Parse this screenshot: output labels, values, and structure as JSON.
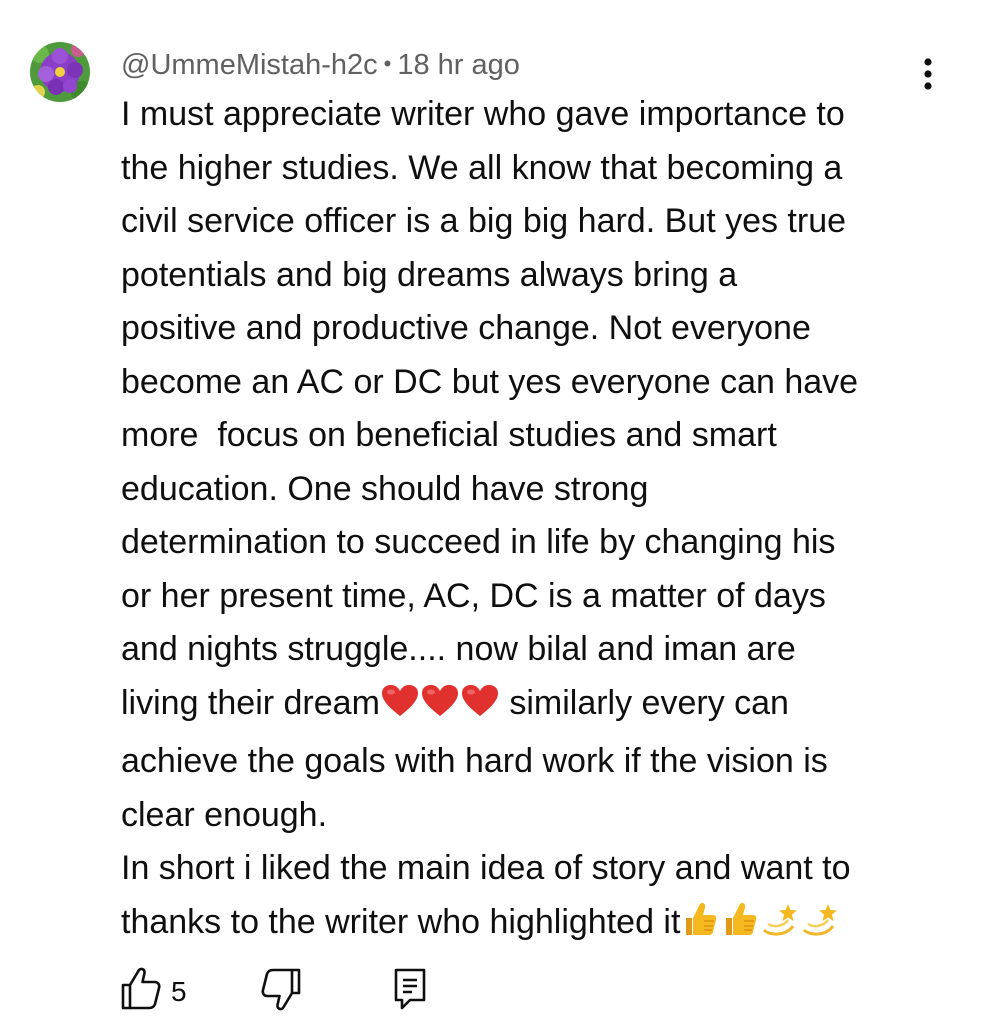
{
  "comment": {
    "author": "@UmmeMistah-h2c",
    "separator": "•",
    "timestamp": "18 hr ago",
    "body_lines": [
      "I must appreciate writer who gave importance to",
      "the higher studies. We all know that becoming a",
      "civil service officer is a big big hard. But yes true",
      "potentials and big dreams always bring a",
      "positive and productive change. Not everyone",
      "become an AC or DC but yes everyone can have",
      "more  focus on beneficial studies and smart",
      "education. One should have strong",
      "determination to succeed in life by changing his",
      "or her present time, AC, DC is a matter of days",
      "and nights struggle.... now bilal and iman are",
      "living their dream",
      " similarly every can",
      "achieve the goals with hard work if the vision is",
      "clear enough.",
      "In short i liked the main idea of story and want to",
      "thanks to the writer who highlighted it"
    ],
    "likes": "5"
  },
  "icons": {
    "avatar": "avatar-flower-icon",
    "menu": "more-vert-icon",
    "heart": "red-heart-emoji",
    "thumbs": "thumbs-up-emoji",
    "dizzy": "dizzy-emoji",
    "like": "thumb-up-outline-icon",
    "dislike": "thumb-down-outline-icon",
    "reply": "reply-comment-icon"
  },
  "colors": {
    "meta_text": "#606060",
    "body_text": "#0f0f0f",
    "heart": "#e0312f",
    "emoji_yellow": "#f6b81f",
    "avatar_green": "#4f9a3c",
    "avatar_purple": "#8b3fc7"
  }
}
